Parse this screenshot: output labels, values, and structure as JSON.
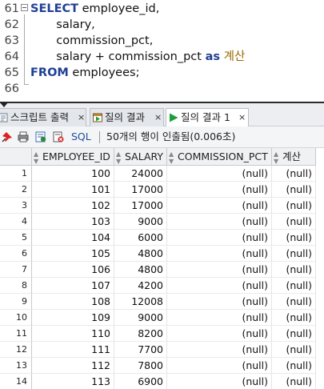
{
  "editor": {
    "lines": [
      {
        "num": "61",
        "parts": [
          {
            "t": "SELECT",
            "cls": "kw"
          },
          {
            "t": " employee_id,",
            "cls": ""
          }
        ]
      },
      {
        "num": "62",
        "parts": [
          {
            "t": "       salary,",
            "cls": ""
          }
        ]
      },
      {
        "num": "63",
        "parts": [
          {
            "t": "       commission_pct,",
            "cls": ""
          }
        ]
      },
      {
        "num": "64",
        "parts": [
          {
            "t": "       salary + commission_pct ",
            "cls": ""
          },
          {
            "t": "as",
            "cls": "kw2"
          },
          {
            "t": " 계산",
            "cls": "alias"
          }
        ]
      },
      {
        "num": "65",
        "parts": [
          {
            "t": "FROM",
            "cls": "kw"
          },
          {
            "t": " employees;",
            "cls": ""
          }
        ]
      },
      {
        "num": "66",
        "parts": []
      }
    ]
  },
  "tabs": [
    {
      "label": "스크립트 출력",
      "close": "×",
      "icon": "script-output-icon",
      "active": false
    },
    {
      "label": "질의 결과",
      "close": "×",
      "icon": "query-result-icon",
      "active": false
    },
    {
      "label": "질의 결과 1",
      "close": "×",
      "icon": "run-play-icon",
      "active": true
    }
  ],
  "toolbar": {
    "sql_label": "SQL",
    "status": "50개의 행이 인출됨(0.006초)",
    "icons": [
      "pin-icon",
      "print-icon",
      "refresh-icon",
      "cancel-query-icon"
    ]
  },
  "grid": {
    "columns": [
      "EMPLOYEE_ID",
      "SALARY",
      "COMMISSION_PCT",
      "계산"
    ],
    "rows": [
      [
        "1",
        "100",
        "24000",
        "(null)",
        "(null)"
      ],
      [
        "2",
        "101",
        "17000",
        "(null)",
        "(null)"
      ],
      [
        "3",
        "102",
        "17000",
        "(null)",
        "(null)"
      ],
      [
        "4",
        "103",
        "9000",
        "(null)",
        "(null)"
      ],
      [
        "5",
        "104",
        "6000",
        "(null)",
        "(null)"
      ],
      [
        "6",
        "105",
        "4800",
        "(null)",
        "(null)"
      ],
      [
        "7",
        "106",
        "4800",
        "(null)",
        "(null)"
      ],
      [
        "8",
        "107",
        "4200",
        "(null)",
        "(null)"
      ],
      [
        "9",
        "108",
        "12008",
        "(null)",
        "(null)"
      ],
      [
        "10",
        "109",
        "9000",
        "(null)",
        "(null)"
      ],
      [
        "11",
        "110",
        "8200",
        "(null)",
        "(null)"
      ],
      [
        "12",
        "111",
        "7700",
        "(null)",
        "(null)"
      ],
      [
        "13",
        "112",
        "7800",
        "(null)",
        "(null)"
      ],
      [
        "14",
        "113",
        "6900",
        "(null)",
        "(null)"
      ]
    ]
  },
  "colors": {
    "keyword": "#1f3f94",
    "alias": "#9a6a00",
    "active_tab_icon": "#1e9e3a"
  }
}
